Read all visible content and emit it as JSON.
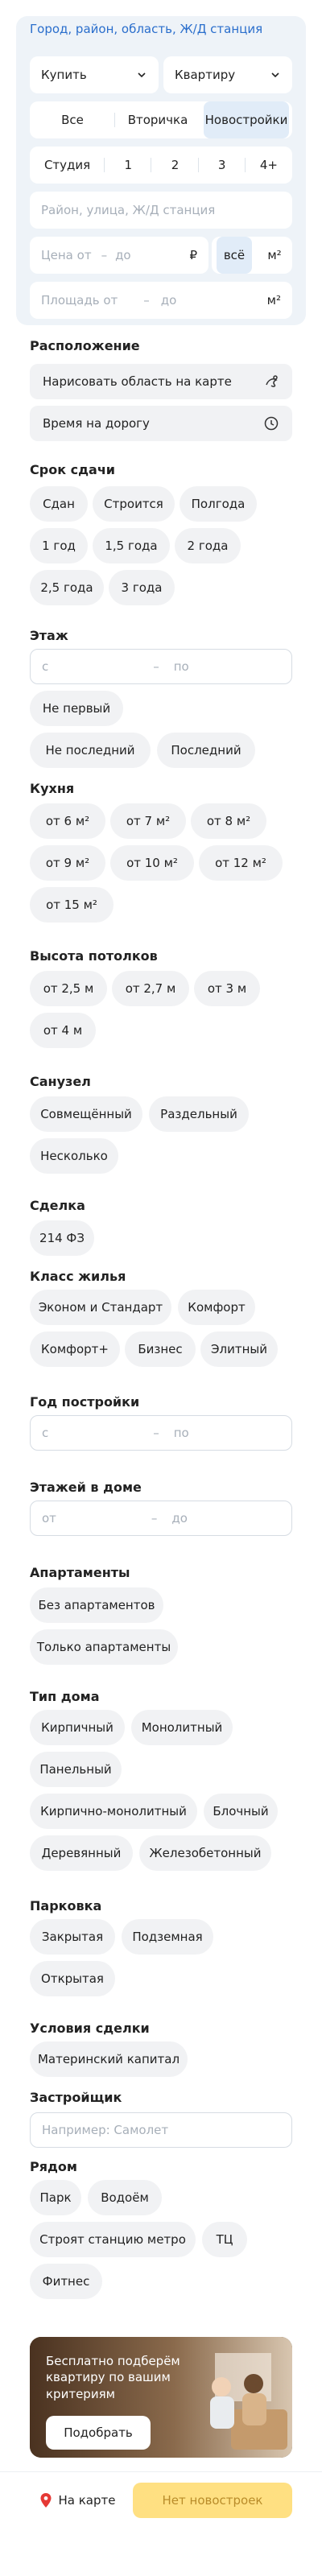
{
  "search": {
    "region_link": "Город, район, область, Ж/Д станция",
    "deal_type": "Купить",
    "property_type": "Квартиру",
    "market": [
      "Все",
      "Вторичка",
      "Новостройки"
    ],
    "rooms": [
      "Студия",
      "1",
      "2",
      "3",
      "4+"
    ],
    "address_placeholder": "Район, улица, Ж/Д станция",
    "price_from": "Цена от",
    "price_to": "до",
    "price_unit": "₽",
    "price_scope": [
      "всё",
      "м²"
    ],
    "area_from": "Площадь от",
    "area_to": "до",
    "area_unit": "м²",
    "range_dash": "–"
  },
  "location": {
    "title": "Расположение",
    "draw_area": "Нарисовать область на карте",
    "travel_time": "Время на дорогу"
  },
  "deadline": {
    "title": "Срок сдачи",
    "options": [
      "Сдан",
      "Строится",
      "Полгода",
      "1 год",
      "1,5 года",
      "2 года",
      "2,5 года",
      "3 года"
    ]
  },
  "floor": {
    "title": "Этаж",
    "from": "с",
    "to": "по",
    "options": [
      "Не первый",
      "Не последний",
      "Последний"
    ]
  },
  "kitchen": {
    "title": "Кухня",
    "options": [
      "от 6 м²",
      "от 7 м²",
      "от 8 м²",
      "от 9 м²",
      "от 10 м²",
      "от 12 м²",
      "от 15 м²"
    ]
  },
  "ceiling": {
    "title": "Высота потолков",
    "options": [
      "от 2,5 м",
      "от 2,7 м",
      "от 3 м",
      "от 4 м"
    ]
  },
  "bathroom": {
    "title": "Санузел",
    "options": [
      "Совмещённый",
      "Раздельный",
      "Несколько"
    ]
  },
  "deal": {
    "title": "Сделка",
    "options": [
      "214 ФЗ"
    ]
  },
  "housing_class": {
    "title": "Класс жилья",
    "options": [
      "Эконом и Стандарт",
      "Комфорт",
      "Комфорт+",
      "Бизнес",
      "Элитный"
    ]
  },
  "build_year": {
    "title": "Год постройки",
    "from": "с",
    "to": "по"
  },
  "floors_in_building": {
    "title": "Этажей в доме",
    "from": "от",
    "to": "до"
  },
  "apartments": {
    "title": "Апартаменты",
    "options": [
      "Без апартаментов",
      "Только апартаменты"
    ]
  },
  "house_type": {
    "title": "Тип дома",
    "options": [
      "Кирпичный",
      "Монолитный",
      "Панельный",
      "Кирпично-монолитный",
      "Блочный",
      "Деревянный",
      "Железобетонный"
    ]
  },
  "parking": {
    "title": "Парковка",
    "options": [
      "Закрытая",
      "Подземная",
      "Открытая"
    ]
  },
  "deal_terms": {
    "title": "Условия сделки",
    "options": [
      "Материнский капитал"
    ]
  },
  "developer": {
    "title": "Застройщик",
    "placeholder": "Например: Самолет"
  },
  "nearby": {
    "title": "Рядом",
    "options": [
      "Парк",
      "Водоём",
      "Строят станцию метро",
      "ТЦ",
      "Фитнес"
    ]
  },
  "promo": {
    "text": "Бесплатно подберём квартиру по вашим критериям",
    "button": "Подобрать"
  },
  "footer": {
    "map_button": "На карте",
    "results_button": "Нет новостроек"
  },
  "colors": {
    "link": "#2a6ecc",
    "chip_bg": "#f1f2f4",
    "cta_bg": "#ffe082",
    "cta_text": "#b98c2a",
    "map_pin": "#e53935",
    "panel_bg": "#eef3f8"
  },
  "icons": {
    "chevron": "chevron-down-icon",
    "draw": "draw-area-icon",
    "clock": "clock-icon",
    "pin": "map-pin-icon"
  }
}
